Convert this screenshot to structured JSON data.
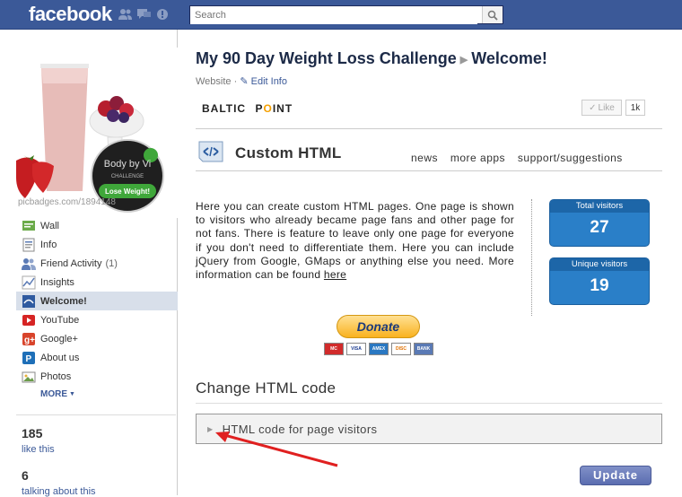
{
  "topbar": {
    "logo": "facebook",
    "search_placeholder": "Search"
  },
  "left": {
    "pic_caption": "picbadges.com/1894148",
    "badge_line1": "Body by Vi",
    "badge_line2": "CHALLENGE",
    "badge_btn": "Lose Weight!",
    "nav": [
      {
        "label": "Wall",
        "icon": "wall-icon"
      },
      {
        "label": "Info",
        "icon": "info-icon"
      },
      {
        "label": "Friend Activity",
        "count": "(1)",
        "icon": "friends-icon"
      },
      {
        "label": "Insights",
        "icon": "insights-icon"
      },
      {
        "label": "Welcome!",
        "icon": "welcome-icon",
        "active": true
      },
      {
        "label": "YouTube",
        "icon": "youtube-icon"
      },
      {
        "label": "Google+",
        "icon": "google-plus-icon"
      },
      {
        "label": "About us",
        "icon": "about-icon"
      },
      {
        "label": "Photos",
        "icon": "photos-icon"
      }
    ],
    "more": "MORE",
    "likes_count": "185",
    "likes_label": "like this",
    "talking_count": "6",
    "talking_label": "talking about this"
  },
  "header": {
    "page_name": "My 90 Day Weight Loss Challenge",
    "tab_name": "Welcome!",
    "category": "Website",
    "edit_info": "Edit Info",
    "brand_a": "BALTIC",
    "brand_b": "P",
    "brand_o": "O",
    "brand_c": "INT",
    "like_label": "Like",
    "like_count": "1k"
  },
  "app": {
    "title": "Custom HTML",
    "links": [
      "news",
      "more apps",
      "support/suggestions"
    ],
    "description": "Here you can create custom HTML pages. One page is shown to visitors who already became page fans and other page for not fans. There is feature to leave only one page for everyone if you don't need to differentiate them. Here you can include jQuery from Google, GMaps or anything else you need. More information can be found ",
    "here_link": "here",
    "total_label": "Total visitors",
    "total_value": "27",
    "unique_label": "Unique visitors",
    "unique_value": "19",
    "donate_label": "Donate",
    "cards": [
      "MC",
      "VISA",
      "AMEX",
      "DISC",
      "BANK"
    ],
    "change_heading": "Change HTML code",
    "accordion_label": "HTML code for page visitors",
    "update_label": "Update"
  },
  "colors": {
    "fb_blue": "#3b5998",
    "stat_blue": "#2a7fc8",
    "arrow_red": "#e02020"
  }
}
